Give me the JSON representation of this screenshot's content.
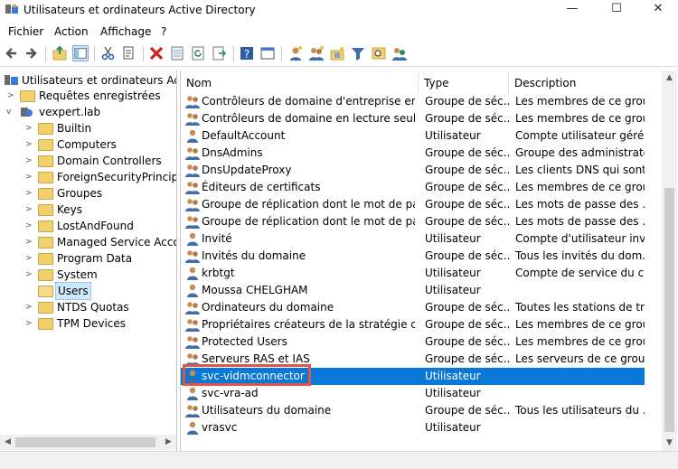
{
  "window": {
    "title": "Utilisateurs et ordinateurs Active Directory",
    "minimize": "—",
    "maximize": "☐",
    "close": "✕"
  },
  "menu": [
    "Fichier",
    "Action",
    "Affichage",
    "?"
  ],
  "tree": {
    "root": "Utilisateurs et ordinateurs Active",
    "saved_queries": "Requêtes enregistrées",
    "domain": "vexpert.lab",
    "children": [
      "Builtin",
      "Computers",
      "Domain Controllers",
      "ForeignSecurityPrincipals",
      "Groupes",
      "Keys",
      "LostAndFound",
      "Managed Service Accounts",
      "Program Data",
      "System",
      "Users",
      "NTDS Quotas",
      "TPM Devices"
    ],
    "selected": "Users"
  },
  "list": {
    "columns": {
      "name": "Nom",
      "type": "Type",
      "description": "Description"
    },
    "rows": [
      {
        "name": "Contrôleurs de domaine d'entreprise en lec...",
        "type": "Groupe de séc...",
        "description": "Les membres de ce grou..."
      },
      {
        "name": "Contrôleurs de domaine en lecture seule",
        "type": "Groupe de séc...",
        "description": "Les membres de ce grou..."
      },
      {
        "name": "DefaultAccount",
        "type": "Utilisateur",
        "description": "Compte utilisateur géré ..."
      },
      {
        "name": "DnsAdmins",
        "type": "Groupe de séc...",
        "description": "Groupe des administrate..."
      },
      {
        "name": "DnsUpdateProxy",
        "type": "Groupe de séc...",
        "description": "Les clients DNS qui sont ..."
      },
      {
        "name": "Éditeurs de certificats",
        "type": "Groupe de séc...",
        "description": "Les membres de ce grou..."
      },
      {
        "name": "Groupe de réplication dont le mot de passe ...",
        "type": "Groupe de séc...",
        "description": "Les mots de passe des ..."
      },
      {
        "name": "Groupe de réplication dont le mot de passe ...",
        "type": "Groupe de séc...",
        "description": "Les mots de passe des ..."
      },
      {
        "name": "Invité",
        "type": "Utilisateur",
        "description": "Compte d'utilisateur inv..."
      },
      {
        "name": "Invités du domaine",
        "type": "Groupe de séc...",
        "description": "Tous les invités du dom..."
      },
      {
        "name": "krbtgt",
        "type": "Utilisateur",
        "description": "Compte de service du c..."
      },
      {
        "name": "Moussa CHELGHAM",
        "type": "Utilisateur",
        "description": ""
      },
      {
        "name": "Ordinateurs du domaine",
        "type": "Groupe de séc...",
        "description": "Toutes les stations de tra..."
      },
      {
        "name": "Propriétaires créateurs de la stratégie de gro...",
        "type": "Groupe de séc...",
        "description": "Les membres de ce grou..."
      },
      {
        "name": "Protected Users",
        "type": "Groupe de séc...",
        "description": "Les membres de ce grou..."
      },
      {
        "name": "Serveurs RAS et IAS",
        "type": "Groupe de séc...",
        "description": "Les serveurs de ce group..."
      },
      {
        "name": "svc-vidmconnector",
        "type": "Utilisateur",
        "description": ""
      },
      {
        "name": "svc-vra-ad",
        "type": "Utilisateur",
        "description": ""
      },
      {
        "name": "Utilisateurs du domaine",
        "type": "Groupe de séc...",
        "description": "Tous les utilisateurs du ..."
      },
      {
        "name": "vrasvc",
        "type": "Utilisateur",
        "description": ""
      }
    ],
    "selected_row": "svc-vidmconnector"
  },
  "colors": {
    "selection": "#0a78d7",
    "highlight_box": "#e0554a",
    "folder": "#f1d06e"
  }
}
